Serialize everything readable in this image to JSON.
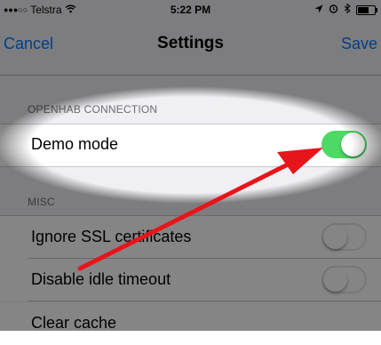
{
  "status_bar": {
    "signal": "●●●○○",
    "carrier": "Telstra",
    "time": "5:22 PM"
  },
  "nav": {
    "cancel_label": "Cancel",
    "title": "Settings",
    "save_label": "Save"
  },
  "sections": {
    "openhab_header": "OPENHAB CONNECTION",
    "misc_header": "MISC"
  },
  "settings": {
    "demo_mode": {
      "label": "Demo mode",
      "enabled": true
    },
    "ignore_ssl": {
      "label": "Ignore SSL certificates",
      "enabled": false
    },
    "disable_idle": {
      "label": "Disable idle timeout",
      "enabled": false
    },
    "clear_cache": {
      "label": "Clear cache"
    }
  },
  "colors": {
    "accent": "#007aff",
    "switch_on": "#4cd964",
    "annotation_arrow": "#e8141c"
  },
  "icons": {
    "wifi": "wifi-icon",
    "location": "location-arrow-icon",
    "alarm": "alarm-icon",
    "bluetooth": "bluetooth-icon",
    "battery": "battery-icon",
    "arrow": "red-arrow-icon"
  }
}
